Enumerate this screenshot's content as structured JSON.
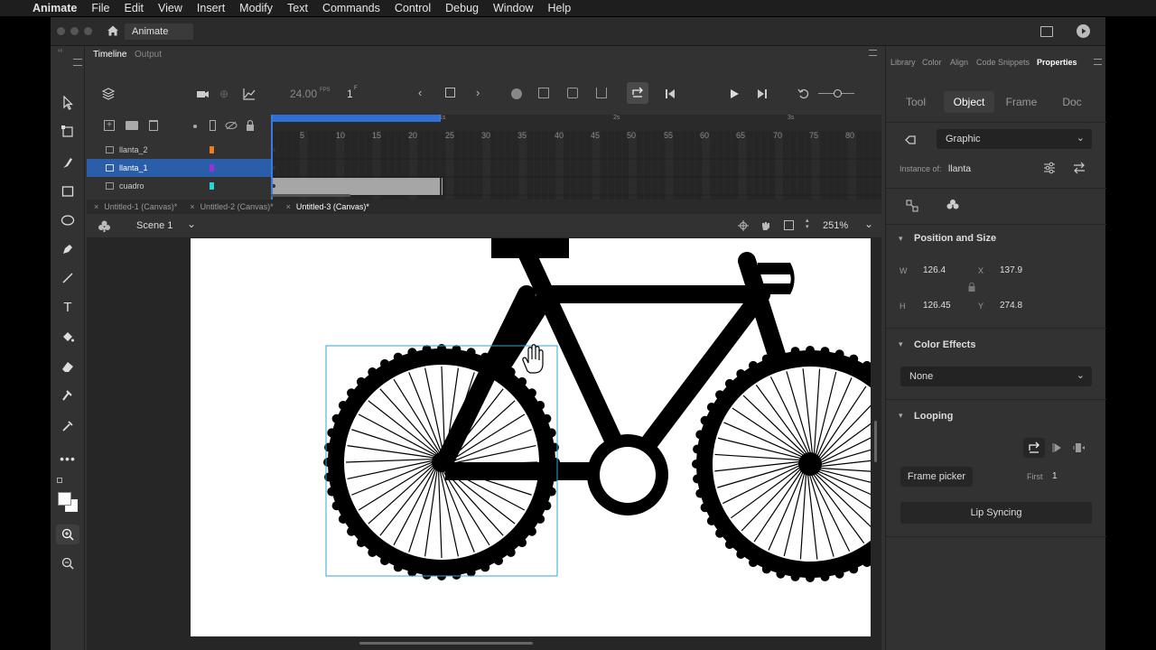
{
  "menubar": {
    "app": "Animate",
    "items": [
      "File",
      "Edit",
      "View",
      "Insert",
      "Modify",
      "Text",
      "Commands",
      "Control",
      "Debug",
      "Window",
      "Help"
    ]
  },
  "titlebar": {
    "title": "Animate"
  },
  "timeline": {
    "tabs": [
      "Timeline",
      "Output"
    ],
    "fps": "24.00",
    "fps_unit": "FPS",
    "frame": "1",
    "frame_unit": "F",
    "layers": [
      {
        "name": "llanta_2",
        "color": "#f07e21",
        "selected": false
      },
      {
        "name": "llanta_1",
        "color": "#9b2fd8",
        "selected": true
      },
      {
        "name": "cuadro",
        "color": "#22d8d8",
        "selected": false
      }
    ],
    "ruler_numbers": [
      "5",
      "10",
      "15",
      "20",
      "25",
      "30",
      "35",
      "40",
      "45",
      "50",
      "55",
      "60",
      "65",
      "70",
      "75",
      "80"
    ],
    "seconds_marks": [
      "1s",
      "2s",
      "3s"
    ]
  },
  "doc_tabs": [
    "Untitled-1 (Canvas)*",
    "Untitled-2 (Canvas)*",
    "Untitled-3 (Canvas)*"
  ],
  "scene": {
    "name": "Scene 1",
    "zoom": "251%"
  },
  "properties": {
    "tabs": [
      "Library",
      "Color",
      "Align",
      "Code Snippets",
      "Properties"
    ],
    "segments": [
      "Tool",
      "Object",
      "Frame",
      "Doc"
    ],
    "symbol_type": "Graphic",
    "instance_of_label": "Instance of:",
    "instance_of": "llanta",
    "position_size_title": "Position and Size",
    "w_label": "W",
    "w": "126.4",
    "x_label": "X",
    "x": "137.9",
    "h_label": "H",
    "h": "126.45",
    "y_label": "Y",
    "y": "274.8",
    "color_effects_title": "Color Effects",
    "color_effect": "None",
    "looping_title": "Looping",
    "frame_picker": "Frame picker",
    "first_label": "First",
    "first": "1",
    "lip_syncing": "Lip Syncing"
  }
}
